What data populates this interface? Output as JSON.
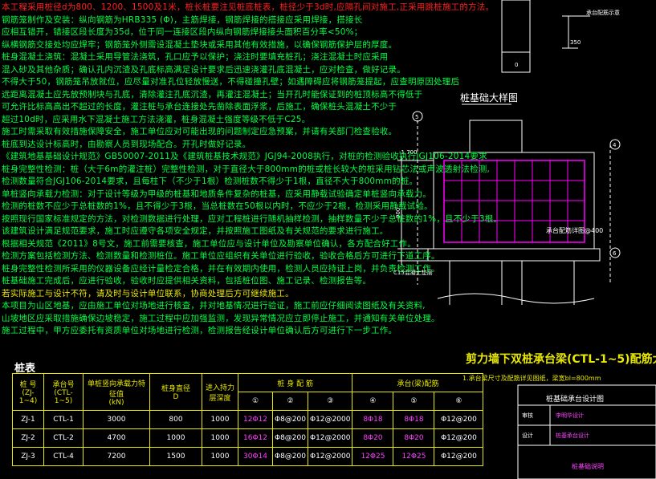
{
  "notes": [
    {
      "text": "本工程采用桩径d为800、1200、1500及1米，桩长桩要注见桩底桩表，桩径少于3d时,应隔孔间对施工,正采用跳桩施工的方法。",
      "color": "red"
    },
    {
      "text": "钢筋笼制作及安装：纵向钢筋为HRB335 (Φ)，主筋焊接，钢筋焊接的搭接应采用焊接，搭接长",
      "color": "green"
    },
    {
      "text": "应相互错开，错接区段长度为35d，位于同一连接区段内纵向钢筋焊接接头面积百分率<50%；",
      "color": "green"
    },
    {
      "text": "纵横钢筋交接处均应焊牢；钢筋笼外侧需设混凝土垫块或采用其他有效措施，以确保钢筋保护层的厚度。",
      "color": "green"
    },
    {
      "text": "桩身混凝土浇筑：混凝土采用导管法浇筑，孔口应予以保护；浇注时要填充桩孔；浇注混凝土时应采用",
      "color": "green"
    },
    {
      "text": "混入砂及其他杂质；确认孔内沉渣及孔底标高满足设计要求后迅速浇灌孔底混凝土，应对检查，做好记录。",
      "color": "green"
    },
    {
      "text": "不得大于50，钢筋笼吊放就位，应尽量对准孔位轻放慢送，不得碰撞孔壁；如遇障碍应将钢筋笼提起，应查明原因处理后",
      "color": "green"
    },
    {
      "text": "远距离混凝土应先放预制块与孔底，清除灌注孔底沉渣，再灌注混凝土；当开孔时能保证到的桩顶标高不得低于",
      "color": "green"
    },
    {
      "text": "可允许比标高高出不超过的长度，灌注桩与承台连接处先凿除表面浮浆，后施工，确保桩头混凝土不少于",
      "color": "green"
    },
    {
      "text": "超过10d时，应采用水下混凝土施工方法浇灌，桩身混凝土强度等级不低于C25。",
      "color": "green"
    },
    {
      "text": "施工时需采取有效措施保障安全，施工单位应对可能出现的问题制定应急预案，并请有关部门检查验收。",
      "color": "green"
    },
    {
      "text": "桩底到达设计标高时，由勘察人员到现场配合。开孔时做好记录。",
      "color": "green"
    },
    {
      "text": "《建筑地基基础设计规范》GB50007-2011及《建筑桩基技术规范》JGJ94-2008执行，对桩的检测验收执行JGJ106-2014要求",
      "color": "green"
    },
    {
      "text": "桩身完整性检测：桩（大于6m的灌注桩）完整性检测，对于直径大于800mm的桩或桩长较大的桩采用钻芯法或声波透射法检测,",
      "color": "green"
    },
    {
      "text": "检测数量符合JGJ106-2014要求，且每柱下（不少于1根）检测桩数不得少于1根，直径不大于800mm的桩。",
      "color": "green"
    },
    {
      "text": "单桩竖向承载力检测：对于设计等级为甲级的桩基和地质条件复杂的桩基，应采用静载试验确定单桩竖向承载力。",
      "color": "green"
    },
    {
      "text": "检测的桩数不应少于总桩数的1%，且不得少于3根，当总桩数在50根以内时，不应少于2根，检测采用静载试验。",
      "color": "green"
    },
    {
      "text": "按照现行国家标准规定的方法，对检测数据进行处理，应对工程桩进行随机抽样检测，抽样数量不少于总桩数的1%，且不少于3根。",
      "color": "green"
    },
    {
      "text": "该建筑设计满足规范要求，施工时应遵守各项安全规定，并按照施工图纸及有关规范的要求进行施工。",
      "color": "green"
    },
    {
      "text": "根据相关规范《2011》8号文，施工前需要核查，施工单位应与设计单位及勘察单位确认，各方配合好工作。",
      "color": "green"
    },
    {
      "text": "检测方案包括检测方法、检测数量和检测桩位。施工单位应组织有关单位进行验收，验收合格后方可进行下道工序。",
      "color": "green"
    },
    {
      "text": "桩身完整性检测所采用的仪器设备应经计量检定合格，并在有效期内使用，检测人员应持证上岗，并负责检测工作。",
      "color": "green"
    },
    {
      "text": "桩基础施工完成后，应进行验收，验收时应提供相关资料，包括桩位图、施工记录、检测报告等。",
      "color": "green"
    },
    {
      "text": "若实际施工与设计不符，请及时与设计单位联系，协商处理后方可继续施工。",
      "color": "yellow"
    },
    {
      "text": "本项目为山区地基，应由施工单位对场地进行核查，并对地基情况进行验证，施工前应仔细阅读图纸及有关资料,",
      "color": "green"
    },
    {
      "text": "山坡地区应采取措施确保边坡稳定，施工过程中应加强监测，发现异常情况应立即停止施工，并通知有关单位处理。",
      "color": "green"
    },
    {
      "text": "施工过程中，甲方应委托有资质单位对场地进行检测，检测报告经设计单位确认后方可进行下一步工作。",
      "color": "green"
    }
  ],
  "detail_title": "桩基础大样图",
  "detail_labels": {
    "elev": "-1.700",
    "dim_h": "100",
    "dim_h2": "900",
    "cover": "C15混凝土垫层",
    "rebar_note": "承台配筋详图@400",
    "axis1": "5",
    "axis2": "4",
    "axis3": "6",
    "top_dim": "350",
    "top_dim2": "150",
    "top_dim3": "0"
  },
  "top_right_label": "承台配筋示意",
  "shear_title": "剪力墙下双桩承台梁(CTL-1~5)配筋大样",
  "shear_note": "1.承台梁尺寸及配筋详见图纸，梁宽bl=800mm",
  "table_title": "桩表",
  "table": {
    "headers": [
      "桩 号",
      "承台号",
      "单桩竖向承载力特征值",
      "桩身直径",
      "进入持力层深度",
      "桩 身 配 筋",
      "承台(梁)配筋"
    ],
    "subheaders": [
      "(ZJ-1~4)",
      "(CTL-1~5)",
      "(kN)",
      "D",
      ""
    ],
    "circle_nums": [
      "①",
      "②",
      "③",
      "④",
      "⑤",
      "⑥"
    ],
    "rows": [
      [
        "ZJ-1",
        "CTL-1",
        "3000",
        "800",
        "1000",
        "12Φ12",
        "Φ8@200",
        "Φ12@2000",
        "8Φ18",
        "8Φ18",
        "Φ12@200"
      ],
      [
        "ZJ-2",
        "CTL-2",
        "4700",
        "1000",
        "1000",
        "16Φ12",
        "Φ8@200",
        "Φ12@2000",
        "8Φ20",
        "8Φ20",
        "Φ12@200"
      ],
      [
        "ZJ-3",
        "CTL-4",
        "7200",
        "1500",
        "1000",
        "30Φ14",
        "Φ8@200",
        "Φ12@2000",
        "12Φ25",
        "12Φ25",
        "Φ12@200"
      ]
    ]
  },
  "titleblock": {
    "title": "桩基础承台设计图",
    "rows": [
      [
        "审核",
        "李明华设计"
      ],
      [
        "设计",
        "桩基承台设计"
      ]
    ],
    "footer": "桩基础说明"
  }
}
